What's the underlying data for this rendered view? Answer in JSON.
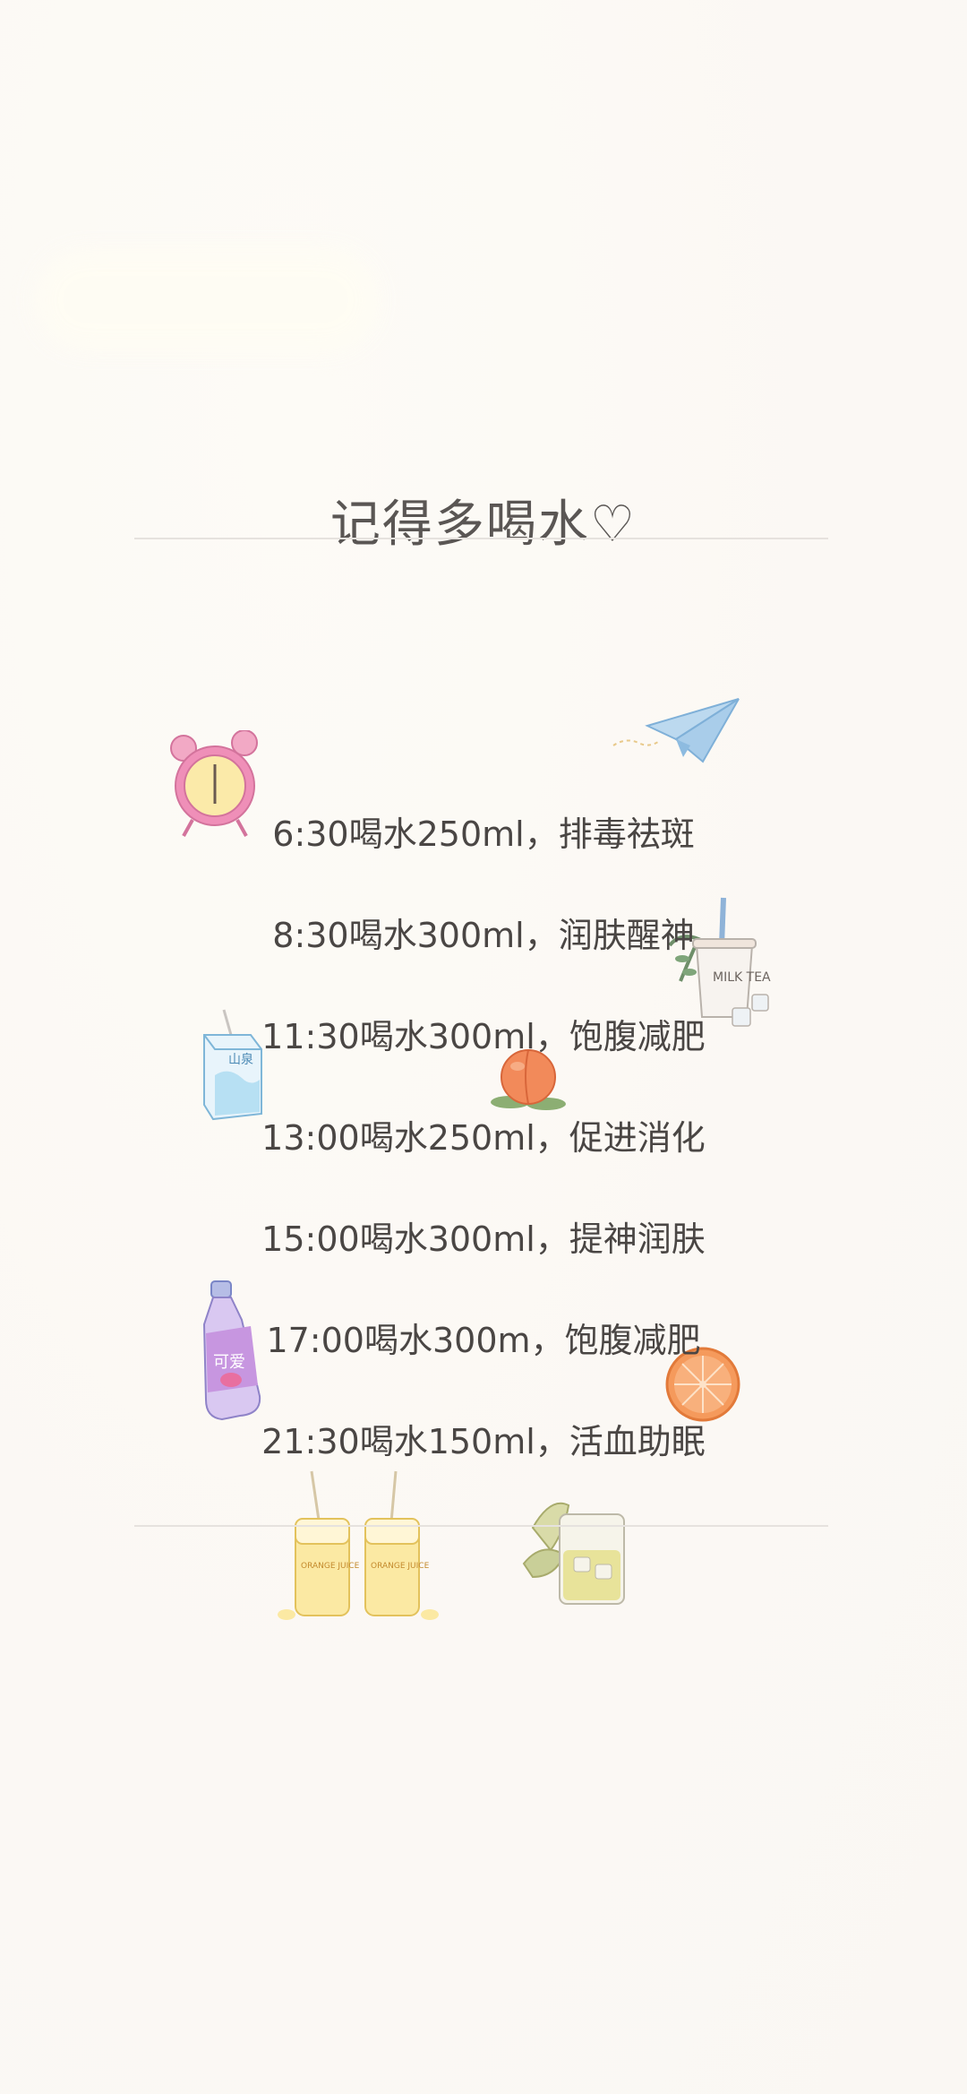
{
  "title": "记得多喝水♡",
  "schedule": [
    {
      "time": "6:30",
      "action": "喝水250ml，",
      "benefit": "排毒祛斑"
    },
    {
      "time": "8:30",
      "action": "喝水300ml，",
      "benefit": "润肤醒神"
    },
    {
      "time": "11:30",
      "action": "喝水300ml，",
      "benefit": "饱腹减肥"
    },
    {
      "time": "13:00",
      "action": "喝水250ml，",
      "benefit": "促进消化"
    },
    {
      "time": "15:00",
      "action": "喝水300ml，",
      "benefit": "提神润肤"
    },
    {
      "time": "17:00",
      "action": "喝水300m，",
      "benefit": "饱腹减肥"
    },
    {
      "time": "21:30",
      "action": "喝水150ml，",
      "benefit": "活血助眠"
    }
  ],
  "decorations": {
    "milk_tea_label": "MILK TEA",
    "juice_box_label": "山泉",
    "bottle_label": "可爱",
    "orange_juice_label": "ORANGE JUICE"
  },
  "colors": {
    "background": "#fcfaf7",
    "text": "#4a4644",
    "title": "#5a5654",
    "rule": "#e6e2de"
  }
}
